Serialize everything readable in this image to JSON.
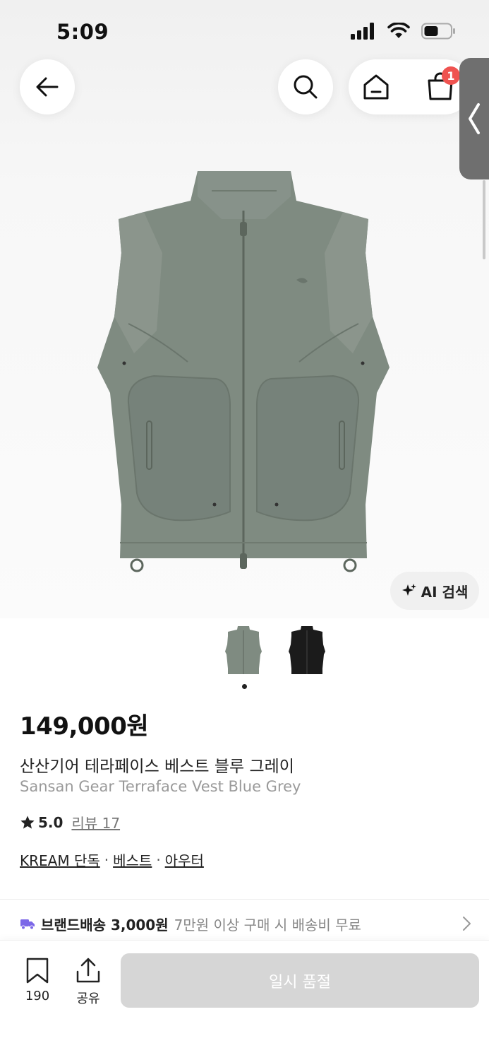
{
  "status_bar": {
    "time": "5:09"
  },
  "header": {
    "cart_count": "1"
  },
  "ai_search": {
    "label": "AI 검색"
  },
  "product": {
    "price": "149,000원",
    "name_ko": "산산기어 테라페이스 베스트 블루 그레이",
    "name_en": "Sansan Gear Terraface Vest Blue Grey",
    "rating": "5.0",
    "review_label": "리뷰 17",
    "tags": [
      "KREAM 단독",
      "베스트",
      "아우터"
    ],
    "tag_separator": "·",
    "thumbnails": [
      {
        "color": "#7f8b81",
        "selected": true
      },
      {
        "color": "#1b1b1b",
        "selected": false
      }
    ],
    "main_color": "#7f8b81"
  },
  "shipping": {
    "label": "브랜드배송 3,000원",
    "note": "7만원 이상 구매 시 배송비 무료",
    "icon": "truck-icon",
    "icon_color": "#7c68e8"
  },
  "bottom_bar": {
    "bookmark_count": "190",
    "share_label": "공유",
    "action_label": "일시 품절"
  },
  "colors": {
    "badge": "#ef5350",
    "soldout_bg": "#d6d6d6"
  }
}
